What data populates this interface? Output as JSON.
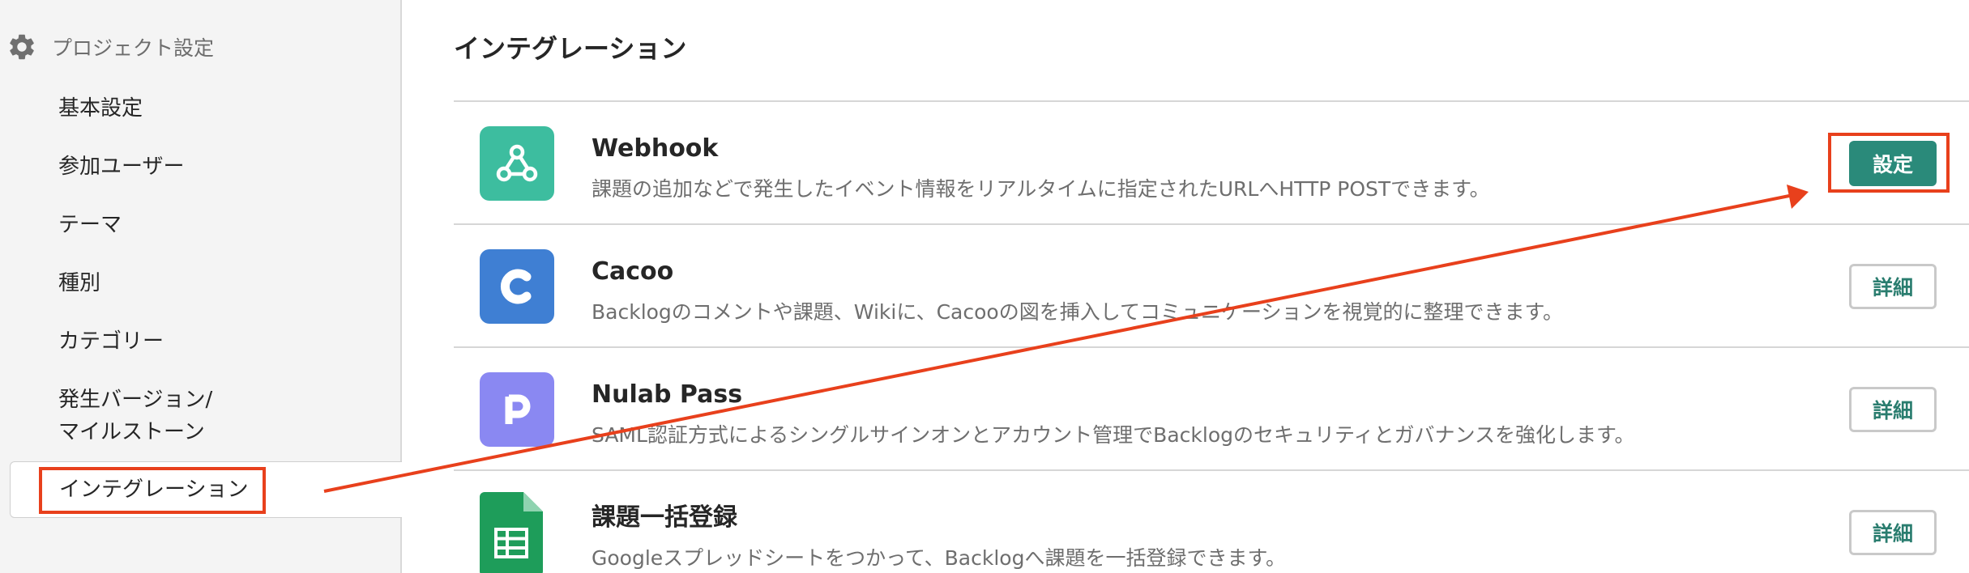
{
  "sidebar": {
    "header": "プロジェクト設定",
    "items": [
      {
        "label": "基本設定"
      },
      {
        "label": "参加ユーザー"
      },
      {
        "label": "テーマ"
      },
      {
        "label": "種別"
      },
      {
        "label": "カテゴリー"
      },
      {
        "label": "発生バージョン/"
      },
      {
        "label": "マイルストーン"
      },
      {
        "label": "インテグレーション"
      }
    ]
  },
  "main": {
    "title": "インテグレーション",
    "integrations": [
      {
        "name": "Webhook",
        "description": "課題の追加などで発生したイベント情報をリアルタイムに指定されたURLへHTTP POSTできます。",
        "button": "設定",
        "icon": "webhook-icon",
        "color": "#3dbd9f"
      },
      {
        "name": "Cacoo",
        "description": "Backlogのコメントや課題、Wikiに、Cacooの図を挿入してコミュニケーションを視覚的に整理できます。",
        "button": "詳細",
        "icon": "cacoo-icon",
        "color": "#3f7fd3"
      },
      {
        "name": "Nulab Pass",
        "description": "SAML認証方式によるシングルサインオンとアカウント管理でBacklogのセキュリティとガバナンスを強化します。",
        "button": "詳細",
        "icon": "nulab-pass-icon",
        "color": "#8a88f2"
      },
      {
        "name": "課題一括登録",
        "description": "Googleスプレッドシートをつかって、Backlogへ課題を一括登録できます。",
        "button": "詳細",
        "icon": "spreadsheet-icon",
        "color": "#1e9d5a"
      }
    ]
  },
  "colors": {
    "accent": "#2a8a7a",
    "annotation": "#e8401c"
  }
}
